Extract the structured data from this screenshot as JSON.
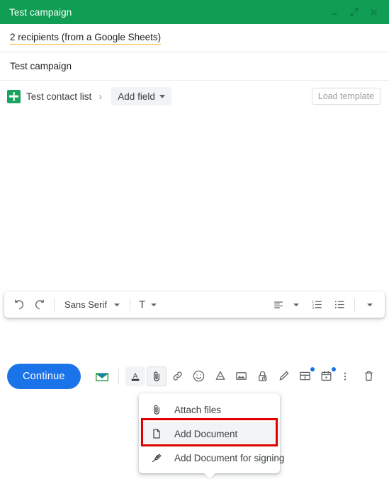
{
  "titlebar": {
    "title": "Test campaign",
    "controls": [
      {
        "name": "minimize",
        "glyph": "minimize-icon"
      },
      {
        "name": "expand",
        "glyph": "expand-icon"
      },
      {
        "name": "close",
        "glyph": "close-icon"
      }
    ],
    "background_color": "#109e54",
    "text_color": "#ffffff"
  },
  "recipients": {
    "text": "2 recipients (from a Google Sheets)",
    "underline_color": "#f1b11f"
  },
  "subject": {
    "text": "Test campaign"
  },
  "contact_row": {
    "sheets_icon": "google-sheets-icon",
    "list_name": "Test contact list",
    "chevron": "›",
    "add_field_label": "Add field",
    "load_template_label": "Load template"
  },
  "format_toolbar": {
    "undo": "undo-icon",
    "redo": "redo-icon",
    "font_family": "Sans Serif",
    "font_size": "T",
    "align": "align-icon",
    "numbered_list": "numbered-list-icon",
    "bulleted_list": "bulleted-list-icon",
    "more": "more-formatting-icon"
  },
  "bottom_bar": {
    "continue_label": "Continue",
    "icons": [
      {
        "name": "tracking-envelope-icon",
        "state": "normal"
      },
      {
        "name": "text-color-icon",
        "state": "boxed"
      },
      {
        "name": "attach-files-icon",
        "state": "active"
      },
      {
        "name": "insert-link-icon",
        "state": "normal"
      },
      {
        "name": "insert-emoji-icon",
        "state": "normal"
      },
      {
        "name": "google-drive-icon",
        "state": "normal"
      },
      {
        "name": "insert-photo-icon",
        "state": "normal"
      },
      {
        "name": "confidential-mode-icon",
        "state": "normal"
      },
      {
        "name": "signature-icon",
        "state": "normal"
      },
      {
        "name": "template-icon",
        "state": "normal",
        "badge": "blue-dot"
      },
      {
        "name": "schedule-icon",
        "state": "normal",
        "badge": "blue-dot"
      },
      {
        "name": "more-options-icon",
        "state": "normal"
      },
      {
        "name": "discard-draft-icon",
        "state": "normal"
      }
    ],
    "accent_color": "#1a73e8"
  },
  "attach_menu": {
    "items": [
      {
        "label": "Attach files",
        "icon": "paperclip-icon",
        "highlighted": false
      },
      {
        "label": "Add Document",
        "icon": "document-icon",
        "highlighted": true
      },
      {
        "label": "Add Document for signing",
        "icon": "signature-pen-icon",
        "highlighted": false
      }
    ],
    "highlight_color": "#e00000"
  }
}
